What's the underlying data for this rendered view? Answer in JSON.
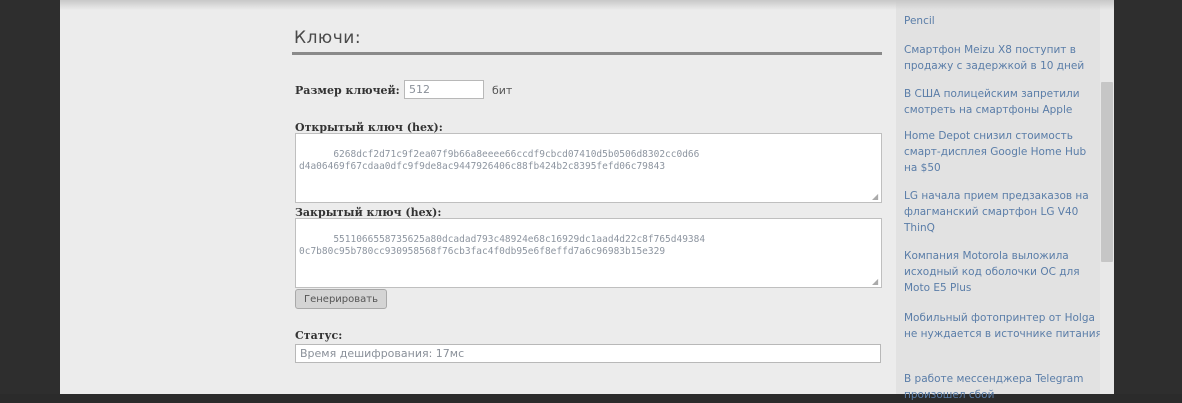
{
  "keys_section": {
    "title": "Ключи:",
    "key_size_label": "Размер ключей:",
    "key_size_value": "512",
    "key_size_unit": "бит",
    "public_key_label": "Открытый ключ (hex):",
    "public_key_value": "6268dcf2d71c9f2ea07f9b66a8eeee66ccdf9cbcd07410d5b0506d8302cc0d66\nd4a06469f67cdaa0dfc9f9de8ac9447926406c88fb424b2c8395fefd06c79843",
    "private_key_label": "Закрытый ключ (hex):",
    "private_key_value": "5511066558735625a80dcadad793c48924e68c16929dc1aad4d22c8f765d49384\n0c7b80c95b780cc930958568f76cb3fac4f0db95e6f8effd7a6c96983b15e329",
    "generate_button": "Генерировать",
    "status_label": "Статус:",
    "status_value": "Время дешифрования: 17мс"
  },
  "sidebar": {
    "news": [
      "Pencil",
      "Смартфон Meizu X8 поступит в продажу с задержкой в 10 дней",
      "В США полицейским запретили смотреть на смартфоны Apple",
      "Home Depot снизил стоимость смарт-дисплея Google Home Hub на $50",
      "LG начала прием предзаказов на флагманский смартфон LG V40 ThinQ",
      "Компания Motorola выложила исходный код оболочки ОС для Moto E5 Plus",
      "Мобильный фотопринтер от Holga не нуждается в источнике питания",
      "В работе мессенджера Telegram произошел сбой"
    ]
  }
}
